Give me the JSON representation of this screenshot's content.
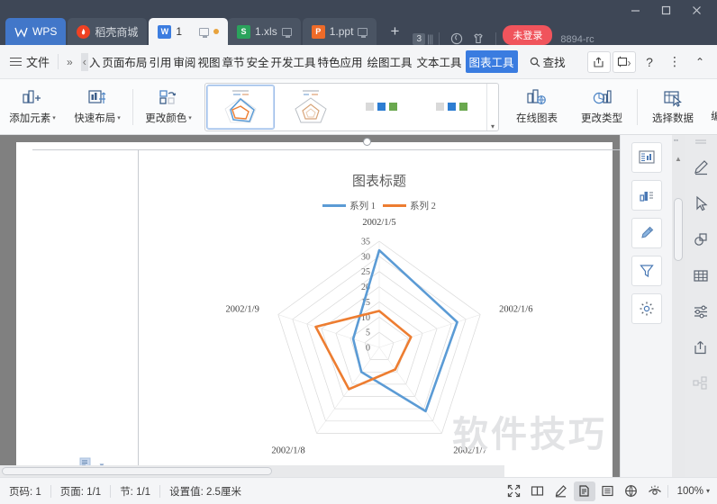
{
  "window": {
    "minimize": "—",
    "maximize": "☐",
    "close": "✕"
  },
  "tabs": [
    {
      "label": "WPS",
      "icon": "wps-logo-icon",
      "kind": "wps"
    },
    {
      "label": "稻壳商城",
      "icon": "rice-shell-mall-icon",
      "kind": "shop"
    },
    {
      "label": "1",
      "icon": "word-doc-icon",
      "kind": "active",
      "modified": true,
      "monitor": true
    },
    {
      "label": "1.xls",
      "icon": "excel-doc-icon",
      "kind": "doc",
      "monitor": true
    },
    {
      "label": "1.ppt",
      "icon": "powerpoint-doc-icon",
      "kind": "doc",
      "monitor": true
    }
  ],
  "titlebar": {
    "new_tab": "+",
    "tab_count": "3",
    "login_status": "未登录",
    "version": "8894-rc"
  },
  "menubar": {
    "file": "文件",
    "overflow": "»",
    "scroll_left": "‹",
    "items": [
      "入",
      "页面布局",
      "引用",
      "审阅",
      "视图",
      "章节",
      "安全",
      "开发工具",
      "特色应用",
      "绘图工具",
      "文本工具"
    ],
    "selected_item": "图表工具",
    "find": "查找",
    "help": "?",
    "more": "⋮",
    "collapse": "⌃"
  },
  "ribbon": {
    "buttons": [
      {
        "label": "添加元素",
        "icon": "add-element-icon",
        "caret": true
      },
      {
        "label": "快速布局",
        "icon": "quick-layout-icon",
        "caret": true
      },
      {
        "label": "更改颜色",
        "icon": "change-color-icon",
        "caret": true
      }
    ],
    "gallery_scroll": "▾",
    "right_buttons": [
      {
        "label": "在线图表",
        "icon": "online-chart-icon"
      },
      {
        "label": "更改类型",
        "icon": "change-type-icon"
      },
      {
        "label": "选择数据",
        "icon": "select-data-icon"
      },
      {
        "label": "编",
        "icon": "edit-icon"
      }
    ],
    "gallery_colors": [
      "#d9d9d9",
      "#2d7dd2",
      "#6aa84f"
    ]
  },
  "chart_data": {
    "type": "radar",
    "title": "图表标题",
    "categories": [
      "2002/1/5",
      "2002/1/6",
      "2002/1/7",
      "2002/1/8",
      "2002/1/9"
    ],
    "tick_labels": [
      "0",
      "5",
      "10",
      "15",
      "20",
      "25",
      "30",
      "35"
    ],
    "rlim": [
      0,
      35
    ],
    "rstep": 5,
    "grid": true,
    "legend_position": "top",
    "series": [
      {
        "name": "系列 1",
        "color": "#5b9bd5",
        "values": [
          32,
          27,
          26,
          10,
          9
        ]
      },
      {
        "name": "系列 2",
        "color": "#ed7d31",
        "values": [
          12,
          11,
          9,
          17,
          22
        ]
      }
    ]
  },
  "document": {
    "watermark": "软件技巧",
    "paragraph_mark_icon": "paragraph-settings-icon"
  },
  "taskpane": {
    "buttons": [
      {
        "icon": "chart-layout-icon",
        "name": "chart-elements"
      },
      {
        "icon": "chart-style-icon",
        "name": "chart-styles"
      },
      {
        "icon": "brush-icon",
        "name": "chart-format"
      },
      {
        "icon": "filter-icon",
        "name": "chart-filter"
      },
      {
        "icon": "gear-icon",
        "name": "chart-settings"
      }
    ]
  },
  "rightbar": {
    "buttons": [
      {
        "icon": "pen-icon",
        "name": "ink-tool"
      },
      {
        "icon": "cursor-icon",
        "name": "select-tool"
      },
      {
        "icon": "shapes-icon",
        "name": "shapes-tool"
      },
      {
        "icon": "table-icon",
        "name": "table-tool"
      },
      {
        "icon": "sliders-icon",
        "name": "adjust-tool"
      },
      {
        "icon": "share-icon",
        "name": "share-tool"
      },
      {
        "icon": "structure-icon",
        "name": "structure-tool"
      }
    ]
  },
  "statusbar": {
    "page_number": "页码: 1",
    "page_of": "页面: 1/1",
    "section": "节: 1/1",
    "setting": "设置值: 2.5厘米",
    "zoom": "100%",
    "zoom_caret": "▾",
    "view_icons": [
      {
        "icon": "fullscreen-icon",
        "name": "full-screen-view"
      },
      {
        "icon": "book-icon",
        "name": "reading-view"
      },
      {
        "icon": "pen-edit-icon",
        "name": "edit-view"
      },
      {
        "icon": "page-icon",
        "name": "page-view",
        "selected": true
      },
      {
        "icon": "outline-icon",
        "name": "outline-view"
      },
      {
        "icon": "web-icon",
        "name": "web-view"
      },
      {
        "icon": "eye-icon",
        "name": "eye-protection"
      }
    ]
  }
}
